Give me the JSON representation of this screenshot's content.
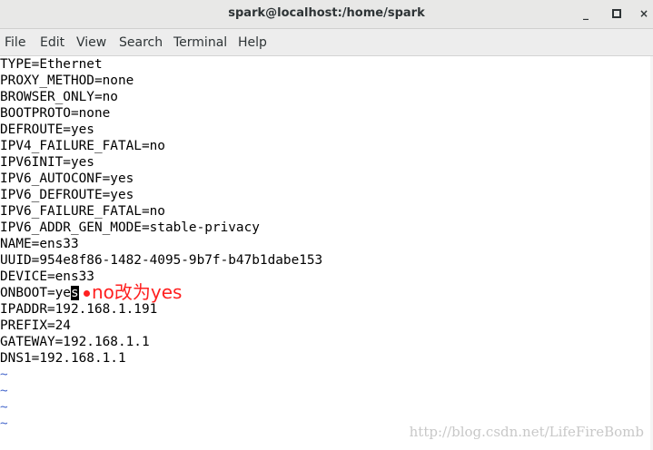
{
  "window": {
    "title": "spark@localhost:/home/spark",
    "minimize_symbol": "_",
    "close_symbol": "×"
  },
  "menu": {
    "file": "File",
    "edit": "Edit",
    "view": "View",
    "search": "Search",
    "terminal": "Terminal",
    "help": "Help"
  },
  "terminal": {
    "lines": [
      "TYPE=Ethernet",
      "PROXY_METHOD=none",
      "BROWSER_ONLY=no",
      "BOOTPROTO=none",
      "DEFROUTE=yes",
      "IPV4_FAILURE_FATAL=no",
      "IPV6INIT=yes",
      "IPV6_AUTOCONF=yes",
      "IPV6_DEFROUTE=yes",
      "IPV6_FAILURE_FATAL=no",
      "IPV6_ADDR_GEN_MODE=stable-privacy",
      "NAME=ens33",
      "UUID=954e8f86-1482-4095-9b7f-b47b1dabe153",
      "DEVICE=ens33",
      "ONBOOT=ye",
      "IPADDR=192.168.1.191",
      "PREFIX=24",
      "GATEWAY=192.168.1.1",
      "DNS1=192.168.1.1"
    ],
    "cursor_char": "s",
    "tilde": "~",
    "annotation": "no改为yes",
    "annotation_color": "#ff2020",
    "watermark": "http://blog.csdn.net/LifeFireBomb",
    "tilde_color": "#4a6bcd"
  }
}
